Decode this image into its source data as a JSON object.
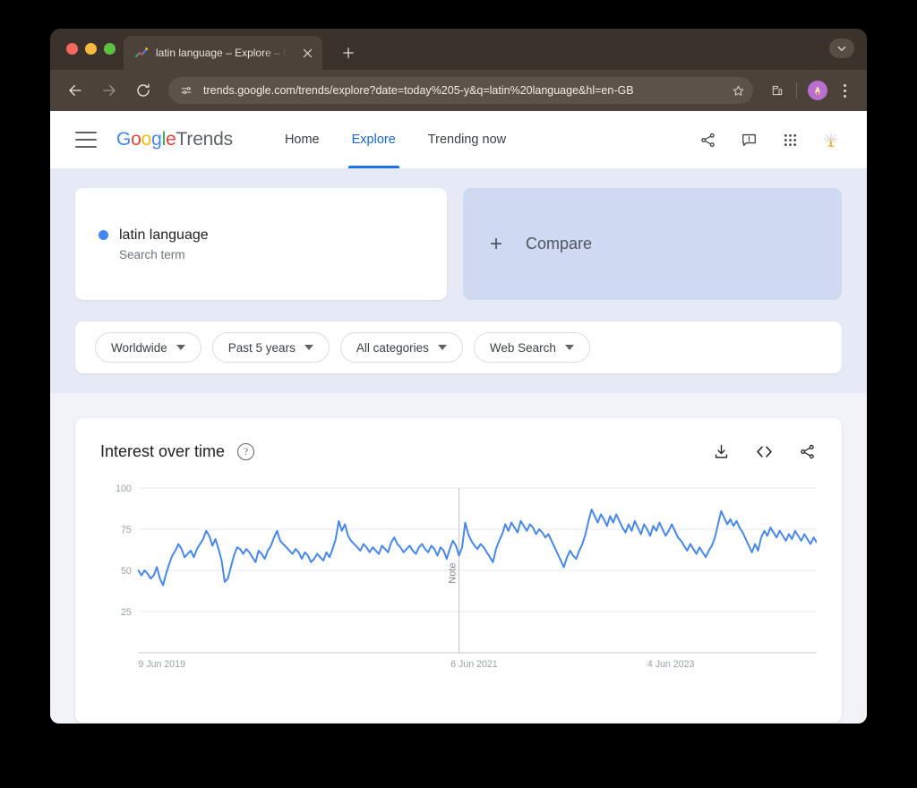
{
  "browser": {
    "tab": {
      "title": "latin language – Explore – Goo",
      "favicon_icon": "trends-spark-icon",
      "close_icon": "close-icon"
    },
    "new_tab_icon": "plus-icon",
    "tab_list_icon": "chevron-down-icon",
    "toolbar": {
      "back_icon": "arrow-left-icon",
      "forward_icon": "arrow-right-icon",
      "reload_icon": "reload-icon",
      "site_info_icon": "tune-settings-icon",
      "url": "trends.google.com/trends/explore?date=today%205-y&q=latin%20language&hl=en-GB",
      "bookmark_icon": "star-icon",
      "extensions_icon": "puzzle-piece-icon",
      "profile_icon": "avatar-icon",
      "menu_icon": "kebab-menu-icon"
    }
  },
  "header": {
    "menu_icon": "hamburger-icon",
    "logo": {
      "g1": "G",
      "o1": "o",
      "o2": "o",
      "g2": "g",
      "l1": "l",
      "e1": "e",
      "product": "Trends"
    },
    "nav": [
      {
        "label": "Home",
        "active": false
      },
      {
        "label": "Explore",
        "active": true
      },
      {
        "label": "Trending now",
        "active": false
      }
    ],
    "icons": [
      {
        "name": "share-icon"
      },
      {
        "name": "feedback-icon"
      },
      {
        "name": "apps-grid-icon"
      },
      {
        "name": "account-avatar-icon"
      }
    ]
  },
  "query": {
    "term": "latin language",
    "term_type": "Search term",
    "term_color": "#4285F4",
    "compare_label": "Compare",
    "compare_plus_icon": "plus-icon"
  },
  "filters": [
    {
      "label": "Worldwide",
      "name": "location-filter"
    },
    {
      "label": "Past 5 years",
      "name": "time-range-filter"
    },
    {
      "label": "All categories",
      "name": "category-filter"
    },
    {
      "label": "Web Search",
      "name": "search-type-filter"
    }
  ],
  "chart_card": {
    "title": "Interest over time",
    "help_icon": "help-circle-icon",
    "help_glyph": "?",
    "actions": [
      {
        "name": "download-csv-icon",
        "label": "download-icon"
      },
      {
        "name": "embed-code-icon",
        "label": "code-icon"
      },
      {
        "name": "share-chart-icon",
        "label": "share-icon"
      }
    ]
  },
  "chart_data": {
    "type": "line",
    "title": "Interest over time",
    "xlabel": "",
    "ylabel": "",
    "ylim": [
      0,
      100
    ],
    "yticks": [
      25,
      50,
      75,
      100
    ],
    "xticks": [
      "9 Jun 2019",
      "6 Jun 2021",
      "4 Jun 2023"
    ],
    "grid": true,
    "legend_position": "none",
    "annotations": [
      {
        "label": "Note",
        "x_index": 104,
        "orientation": "vertical"
      }
    ],
    "series": [
      {
        "name": "latin language",
        "color": "#4285F4",
        "values": [
          50,
          47,
          50,
          48,
          45,
          47,
          52,
          45,
          41,
          48,
          54,
          59,
          62,
          66,
          63,
          58,
          60,
          62,
          58,
          63,
          66,
          69,
          74,
          71,
          65,
          69,
          63,
          56,
          43,
          45,
          52,
          59,
          64,
          63,
          60,
          63,
          61,
          58,
          55,
          62,
          60,
          57,
          62,
          65,
          70,
          74,
          68,
          66,
          64,
          62,
          60,
          63,
          61,
          57,
          61,
          59,
          55,
          57,
          60,
          58,
          56,
          61,
          58,
          63,
          69,
          80,
          74,
          78,
          71,
          68,
          66,
          64,
          62,
          66,
          64,
          61,
          64,
          62,
          60,
          65,
          63,
          61,
          67,
          70,
          66,
          64,
          61,
          63,
          65,
          62,
          60,
          64,
          66,
          63,
          61,
          65,
          63,
          59,
          64,
          62,
          57,
          63,
          68,
          65,
          59,
          64,
          79,
          72,
          68,
          65,
          63,
          66,
          64,
          61,
          58,
          55,
          63,
          68,
          72,
          78,
          74,
          79,
          76,
          73,
          80,
          77,
          74,
          78,
          76,
          72,
          75,
          73,
          70,
          72,
          68,
          64,
          60,
          56,
          52,
          58,
          62,
          59,
          57,
          62,
          66,
          72,
          80,
          87,
          83,
          79,
          84,
          81,
          77,
          83,
          79,
          84,
          80,
          76,
          73,
          78,
          74,
          80,
          76,
          72,
          78,
          75,
          71,
          77,
          74,
          79,
          75,
          71,
          74,
          78,
          74,
          70,
          68,
          65,
          62,
          66,
          63,
          60,
          64,
          61,
          58,
          62,
          65,
          70,
          78,
          86,
          82,
          78,
          81,
          77,
          80,
          76,
          73,
          69,
          65,
          61,
          66,
          62,
          70,
          74,
          71,
          76,
          73,
          70,
          74,
          71,
          68,
          72,
          69,
          74,
          71,
          68,
          72,
          69,
          66,
          70,
          67
        ]
      }
    ]
  }
}
